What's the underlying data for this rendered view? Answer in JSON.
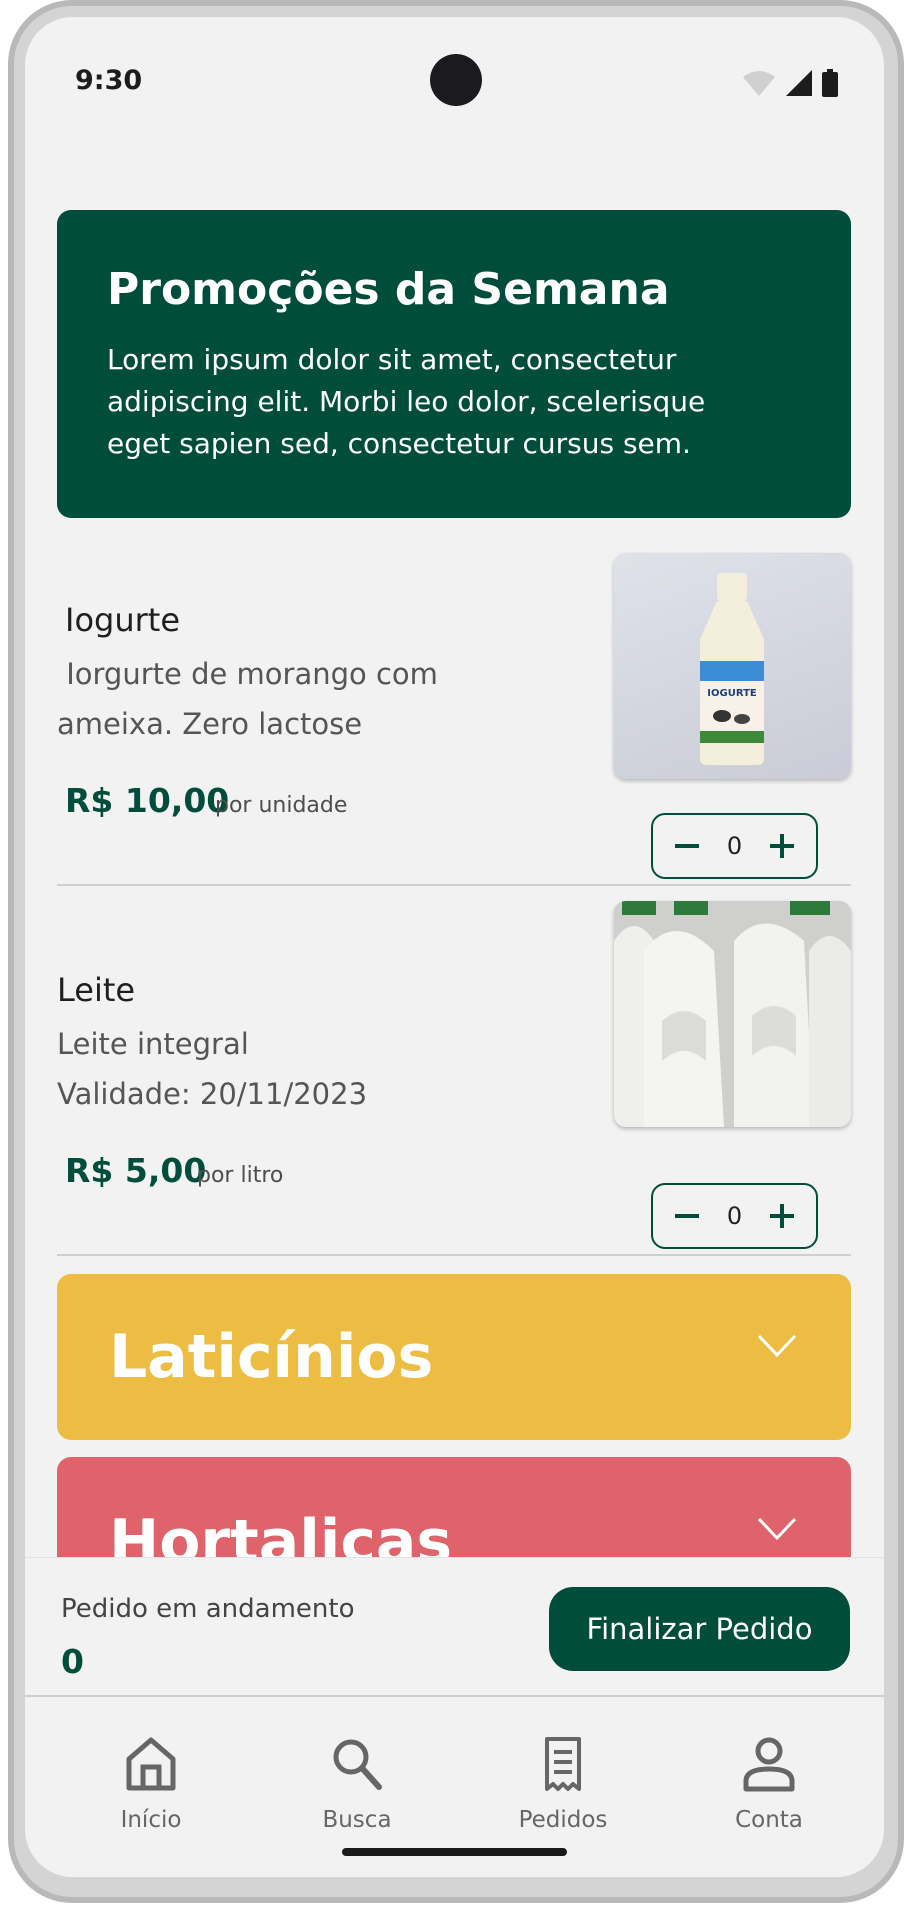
{
  "status_bar": {
    "time": "9:30"
  },
  "promo": {
    "title": "Promoções da Semana",
    "text": "Lorem ipsum dolor sit amet, consectetur adipiscing elit. Morbi leo dolor, scelerisque eget sapien sed, consectetur cursus sem."
  },
  "products": [
    {
      "name": "Iogurte",
      "desc_line1": " Iorgurte de morango com",
      "desc_line2": "ameixa. Zero lactose",
      "price": "R$ 10,00",
      "unit": "por unidade",
      "quantity": "0",
      "bottle_label": "IOGURTE"
    },
    {
      "name": "Leite",
      "desc_line1": "Leite integral",
      "desc_line2": "Validade: 20/11/2023",
      "price": "R$ 5,00",
      "unit": "por litro",
      "quantity": "0"
    }
  ],
  "categories": [
    {
      "label": "Laticínios",
      "color": "#ecbc43"
    },
    {
      "label": "Hortaliças",
      "color": "#df636a"
    }
  ],
  "order_bar": {
    "label": "Pedido em andamento",
    "count": "0",
    "button": "Finalizar Pedido"
  },
  "nav": [
    {
      "label": "Início",
      "icon": "home-icon"
    },
    {
      "label": "Busca",
      "icon": "search-icon"
    },
    {
      "label": "Pedidos",
      "icon": "receipt-icon"
    },
    {
      "label": "Conta",
      "icon": "person-icon"
    }
  ],
  "colors": {
    "primary": "#004d3b",
    "background": "#f2f2f2"
  }
}
